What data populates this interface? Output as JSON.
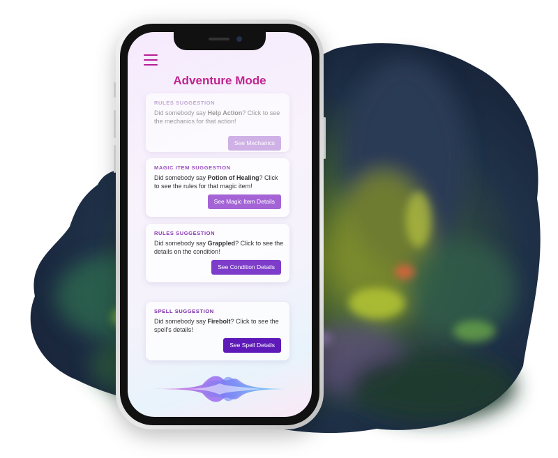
{
  "app": {
    "title": "Adventure Mode"
  },
  "colors": {
    "title": "#c0248f",
    "menu": "#b61e97"
  },
  "cards": [
    {
      "label": "RULES SUGGESTION",
      "text_prefix": "Did somebody say ",
      "keyword": "Help Action",
      "text_suffix": "? Click to see the mechanics for that action!",
      "button": "See Mechanics",
      "label_color": "#b79ac9",
      "button_color": "#c9a6e3",
      "faded": true
    },
    {
      "label": "MAGIC ITEM SUGGESTION",
      "text_prefix": "Did somebody say ",
      "keyword": "Potion of Healing",
      "text_suffix": "? Click to see the rules for that magic item!",
      "button": "See Magic Item Details",
      "label_color": "#9b4fbf",
      "button_color": "#a464d6",
      "faded": false
    },
    {
      "label": "RULES SUGGESTION",
      "text_prefix": "Did somebody say ",
      "keyword": "Grappled",
      "text_suffix": "? Click to see the details on the condition!",
      "button": "See Condition Details",
      "label_color": "#8a3bb8",
      "button_color": "#7d3cc9",
      "faded": false
    },
    {
      "label": "SPELL SUGGESTION",
      "text_prefix": "Did somebody say ",
      "keyword": "Firebolt",
      "text_suffix": "? Click to see the spell's details!",
      "button": "See Spell Details",
      "label_color": "#7a2aa8",
      "button_color": "#5e1ab8",
      "faded": false
    }
  ],
  "icons": {
    "menu": "hamburger-menu-icon",
    "voice": "voice-waveform-icon"
  }
}
